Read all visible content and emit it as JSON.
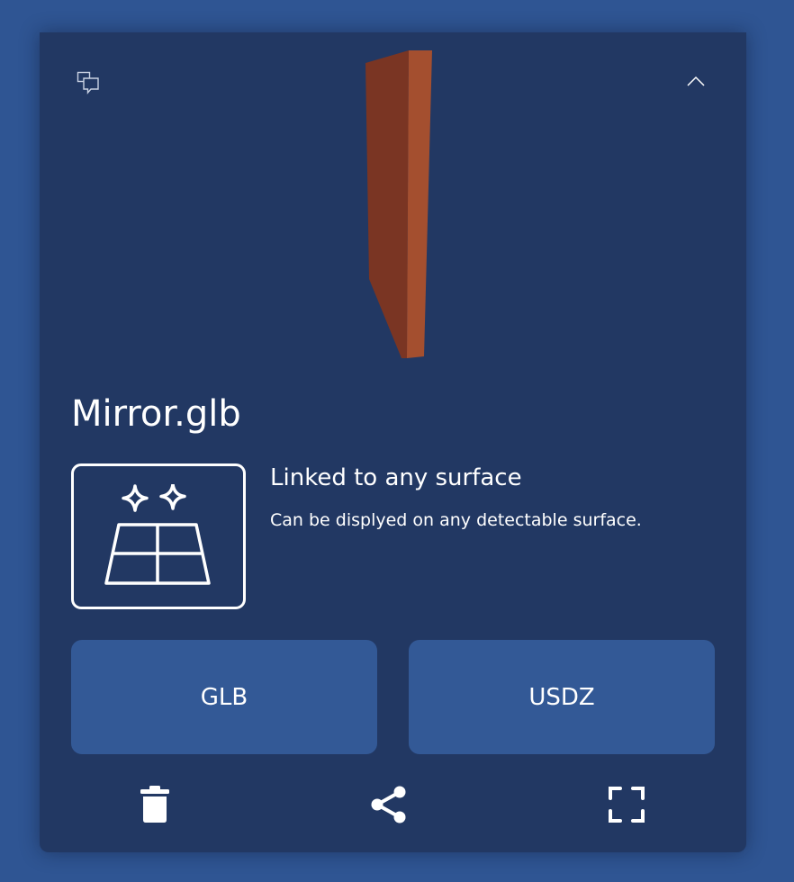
{
  "model": {
    "file_name": "Mirror.glb",
    "colors": {
      "front": "#a44f2f",
      "side": "#7a3523"
    }
  },
  "placement": {
    "title": "Linked to any surface",
    "description": "Can be displyed on any detectable surface.",
    "icon": "surface-sparkle-icon"
  },
  "formats": [
    {
      "label": "GLB"
    },
    {
      "label": "USDZ"
    }
  ],
  "toolbar": {
    "chat_icon": "chat-bubbles-icon",
    "collapse_icon": "chevron-up-icon"
  },
  "actions": {
    "delete_icon": "trash-icon",
    "share_icon": "share-icon",
    "fullscreen_icon": "fullscreen-icon"
  },
  "colors": {
    "page_background": "#2f5593",
    "card_background": "#223863",
    "button_background": "#335996",
    "text": "#ffffff"
  }
}
